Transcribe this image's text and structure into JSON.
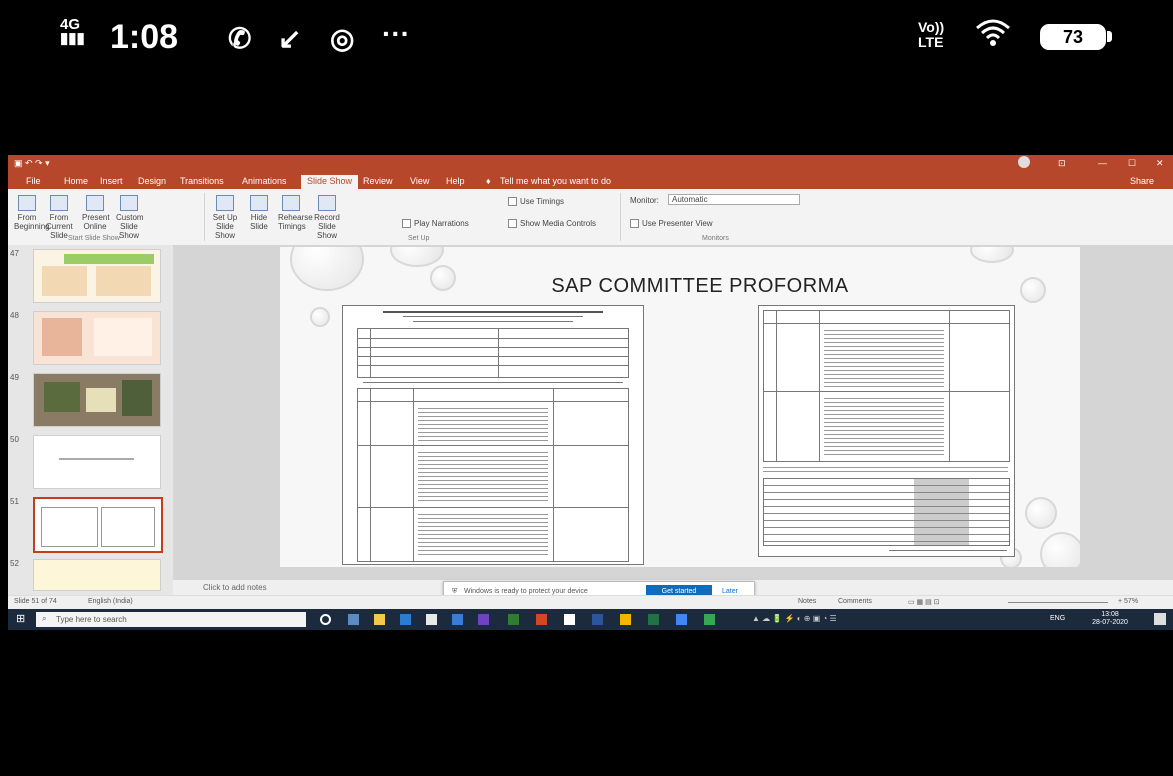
{
  "status_bar": {
    "signal": "4G",
    "time": "1:08",
    "network": "VoLTE",
    "network_line1": "Vo))",
    "network_line2": "LTE",
    "battery": "73",
    "icons": [
      "whatsapp-icon",
      "missed-call-icon",
      "chrome-icon",
      "more-icon",
      "wifi-icon",
      "battery-icon"
    ],
    "overflow": "···"
  },
  "app": {
    "accent": "#b7472a",
    "title": "SAP COMMITTEE PROFORMA",
    "ribbon_tabs": [
      "File",
      "Home",
      "Insert",
      "Design",
      "Transitions",
      "Animations",
      "Slide Show",
      "Review",
      "View",
      "Help"
    ],
    "active_tab": "Slide Show",
    "tell_me": "Tell me what you want to do",
    "share": "Share",
    "ribbon_groups": {
      "start": "Start Slide Show",
      "setup": "Set Up",
      "monitors": "Monitors"
    },
    "ribbon_buttons": [
      "From Beginning",
      "From Current Slide",
      "Present Online",
      "Custom Slide Show",
      "Set Up Slide Show",
      "Hide Slide",
      "Rehearse Timings",
      "Record Slide Show"
    ],
    "checkboxes": [
      "Play Narrations",
      "Use Timings",
      "Show Media Controls",
      "Use Presenter View"
    ],
    "monitor_label": "Monitor:",
    "monitor_value": "Automatic",
    "slide_numbers": [
      "47",
      "48",
      "49",
      "50",
      "51",
      "52"
    ],
    "notes_placeholder": "Click to add notes",
    "status_left": "Slide 51 of 74",
    "status_lang": "English (India)",
    "status_notes": "Notes",
    "status_comments": "Comments",
    "status_zoom": "+ 57%"
  },
  "popup": {
    "message": "Windows is ready to protect your device",
    "button": "Get started",
    "close": "Later"
  },
  "taskbar": {
    "search_placeholder": "Type here to search",
    "time": "13:08",
    "date": "28-07-2020",
    "lang": "ENG"
  }
}
